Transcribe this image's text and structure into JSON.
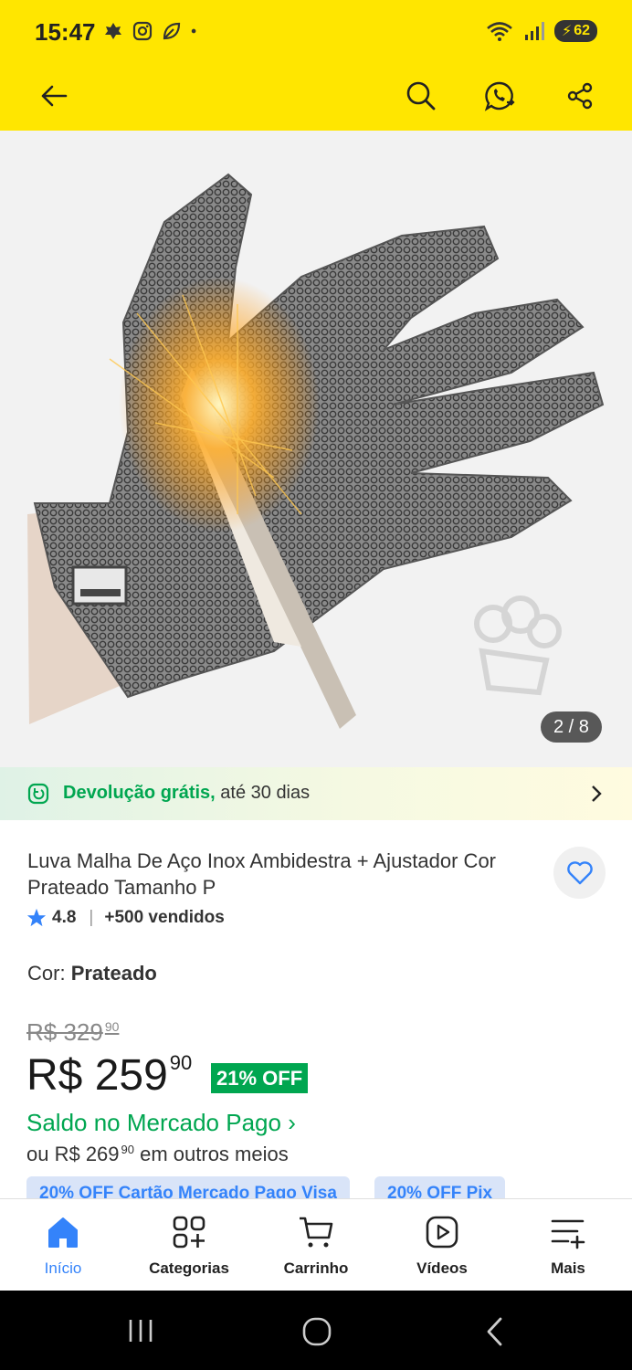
{
  "status_bar": {
    "time": "15:47",
    "battery": "62"
  },
  "header": {
    "back_icon": "arrow-left-icon",
    "search_icon": "search-icon",
    "whatsapp_icon": "whatsapp-share-icon",
    "share_icon": "share-icon"
  },
  "gallery": {
    "counter": "2 / 8"
  },
  "banner": {
    "highlight": "Devolução grátis,",
    "rest": " até 30 dias"
  },
  "product": {
    "title": "Luva Malha De Aço Inox Ambidestra + Ajustador Cor Prateado Tamanho P",
    "rating": "4.8",
    "sold": "+500 vendidos",
    "color_label": "Cor: ",
    "color_value": "Prateado"
  },
  "pricing": {
    "old_price": "R$ 329",
    "old_cents": "90",
    "price": "R$ 259",
    "price_cents": "90",
    "discount": "21% OFF",
    "saldo": "Saldo no Mercado Pago ›",
    "alt_prefix": "ou R$ 269",
    "alt_cents": "90",
    "alt_suffix": " em outros meios"
  },
  "chips": [
    "20% OFF Cartão Mercado Pago Visa",
    "20% OFF Pix"
  ],
  "bottom_nav": [
    {
      "label": "Início",
      "icon": "home-icon",
      "active": true
    },
    {
      "label": "Categorias",
      "icon": "categories-icon",
      "active": false
    },
    {
      "label": "Carrinho",
      "icon": "cart-icon",
      "active": false
    },
    {
      "label": "Vídeos",
      "icon": "video-icon",
      "active": false
    },
    {
      "label": "Mais",
      "icon": "more-icon",
      "active": false
    }
  ],
  "colors": {
    "header": "#FFE600",
    "accent": "#3483fa",
    "green": "#00a650"
  }
}
